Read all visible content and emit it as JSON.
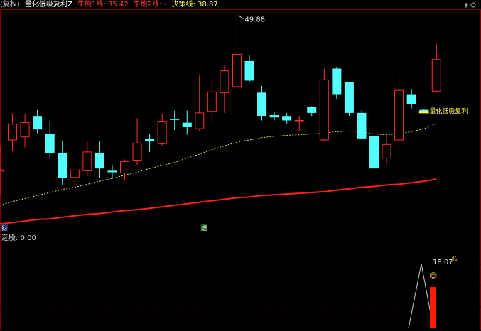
{
  "legend": {
    "prefix": "(复权)",
    "indicator": "量化低吸复利Z",
    "ma1_label": "牛熊1线: 35.42",
    "ma2_label": "牛熊2线: -",
    "decision_label": "决策线: 38.87"
  },
  "colors": {
    "up": "#ff3030",
    "down": "#54ffff",
    "ma1": "#e0e070",
    "ma2": "#ff2020",
    "signal_bar": "#ff1a00",
    "grid": "#7a0000"
  },
  "chart_data": {
    "type": "candlestick",
    "ylim": [
      21,
      50.5
    ],
    "candles": [
      {
        "o": 29.2,
        "h": 32.5,
        "l": 25.9,
        "c": 29.2
      },
      {
        "o": 33.2,
        "h": 36.6,
        "l": 31.7,
        "c": 35.3
      },
      {
        "o": 33.6,
        "h": 36.6,
        "l": 32.2,
        "c": 35.5
      },
      {
        "o": 36.3,
        "h": 37.2,
        "l": 34.1,
        "c": 34.6
      },
      {
        "o": 34.0,
        "h": 35.6,
        "l": 30.7,
        "c": 31.5
      },
      {
        "o": 31.5,
        "h": 33.1,
        "l": 27.2,
        "c": 28.1
      },
      {
        "o": 28.2,
        "h": 28.9,
        "l": 26.8,
        "c": 29.2
      },
      {
        "o": 29.1,
        "h": 33.0,
        "l": 28.4,
        "c": 31.6
      },
      {
        "o": 31.5,
        "h": 33.0,
        "l": 28.1,
        "c": 29.4
      },
      {
        "o": 29.1,
        "h": 29.9,
        "l": 28.0,
        "c": 28.9
      },
      {
        "o": 28.8,
        "h": 30.6,
        "l": 27.9,
        "c": 30.3
      },
      {
        "o": 30.5,
        "h": 36.1,
        "l": 29.8,
        "c": 32.8
      },
      {
        "o": 33.3,
        "h": 34.0,
        "l": 31.6,
        "c": 33.0
      },
      {
        "o": 32.7,
        "h": 36.6,
        "l": 32.4,
        "c": 35.6
      },
      {
        "o": 36.0,
        "h": 37.1,
        "l": 34.5,
        "c": 35.9
      },
      {
        "o": 35.5,
        "h": 37.1,
        "l": 33.9,
        "c": 34.9
      },
      {
        "o": 34.7,
        "h": 41.8,
        "l": 34.4,
        "c": 36.8
      },
      {
        "o": 37.0,
        "h": 41.6,
        "l": 35.3,
        "c": 39.6
      },
      {
        "o": 39.5,
        "h": 43.1,
        "l": 36.8,
        "c": 42.4
      },
      {
        "o": 40.3,
        "h": 49.88,
        "l": 39.7,
        "c": 44.6
      },
      {
        "o": 43.7,
        "h": 44.5,
        "l": 40.9,
        "c": 41.1
      },
      {
        "o": 39.5,
        "h": 40.4,
        "l": 35.8,
        "c": 36.4
      },
      {
        "o": 36.5,
        "h": 37.0,
        "l": 35.8,
        "c": 36.2
      },
      {
        "o": 36.3,
        "h": 36.8,
        "l": 35.4,
        "c": 35.8
      },
      {
        "o": 35.8,
        "h": 36.4,
        "l": 34.4,
        "c": 35.8
      },
      {
        "o": 37.6,
        "h": 37.7,
        "l": 36.3,
        "c": 36.8
      },
      {
        "o": 33.2,
        "h": 42.7,
        "l": 33.1,
        "c": 41.2
      },
      {
        "o": 42.7,
        "h": 42.9,
        "l": 38.6,
        "c": 39.2
      },
      {
        "o": 40.9,
        "h": 40.9,
        "l": 36.4,
        "c": 36.8
      },
      {
        "o": 36.8,
        "h": 37.1,
        "l": 33.4,
        "c": 33.4
      },
      {
        "o": 33.7,
        "h": 33.8,
        "l": 28.9,
        "c": 29.4
      },
      {
        "o": 30.8,
        "h": 33.6,
        "l": 29.9,
        "c": 32.6
      },
      {
        "o": 33.2,
        "h": 41.7,
        "l": 33.2,
        "c": 39.8
      },
      {
        "o": 39.2,
        "h": 39.9,
        "l": 37.4,
        "c": 38.0
      },
      {
        "o": 37.2,
        "h": 37.3,
        "l": 36.8,
        "c": 37.0
      },
      {
        "o": 39.7,
        "h": 46.0,
        "l": 39.6,
        "c": 43.9
      }
    ],
    "ma1": [
      24.5,
      25.0,
      25.4,
      25.8,
      26.2,
      26.6,
      26.9,
      27.3,
      27.7,
      28.1,
      28.5,
      28.9,
      29.4,
      29.8,
      30.2,
      30.8,
      31.3,
      31.9,
      32.4,
      32.9,
      33.2,
      33.5,
      33.7,
      33.8,
      33.9,
      34.0,
      34.1,
      34.3,
      34.4,
      34.3,
      34.0,
      33.9,
      34.0,
      34.3,
      34.7,
      35.4
    ],
    "ma2": [
      22.0,
      22.2,
      22.4,
      22.6,
      22.7,
      22.9,
      23.1,
      23.3,
      23.4,
      23.6,
      23.8,
      23.9,
      24.1,
      24.3,
      24.5,
      24.7,
      24.9,
      25.1,
      25.3,
      25.5,
      25.6,
      25.8,
      25.9,
      26.0,
      26.1,
      26.2,
      26.3,
      26.5,
      26.7,
      26.9,
      27.0,
      27.2,
      27.3,
      27.5,
      27.7,
      28.0
    ],
    "decision_marker": {
      "index": 34,
      "value": 36.9
    },
    "high_annotation": {
      "index": 19,
      "text": "49.88"
    },
    "line_label": {
      "text": "量化低吸复利"
    },
    "bottom_tags": [
      {
        "index": 0,
        "text": "财"
      },
      {
        "index": 16,
        "text": "送"
      }
    ],
    "sub": {
      "label": "选股: 0.00",
      "ylim": [
        0,
        24
      ],
      "peak_value": 18.07,
      "peak_label": "18.07",
      "peak_suffix": "%",
      "emoji": "😊"
    }
  }
}
